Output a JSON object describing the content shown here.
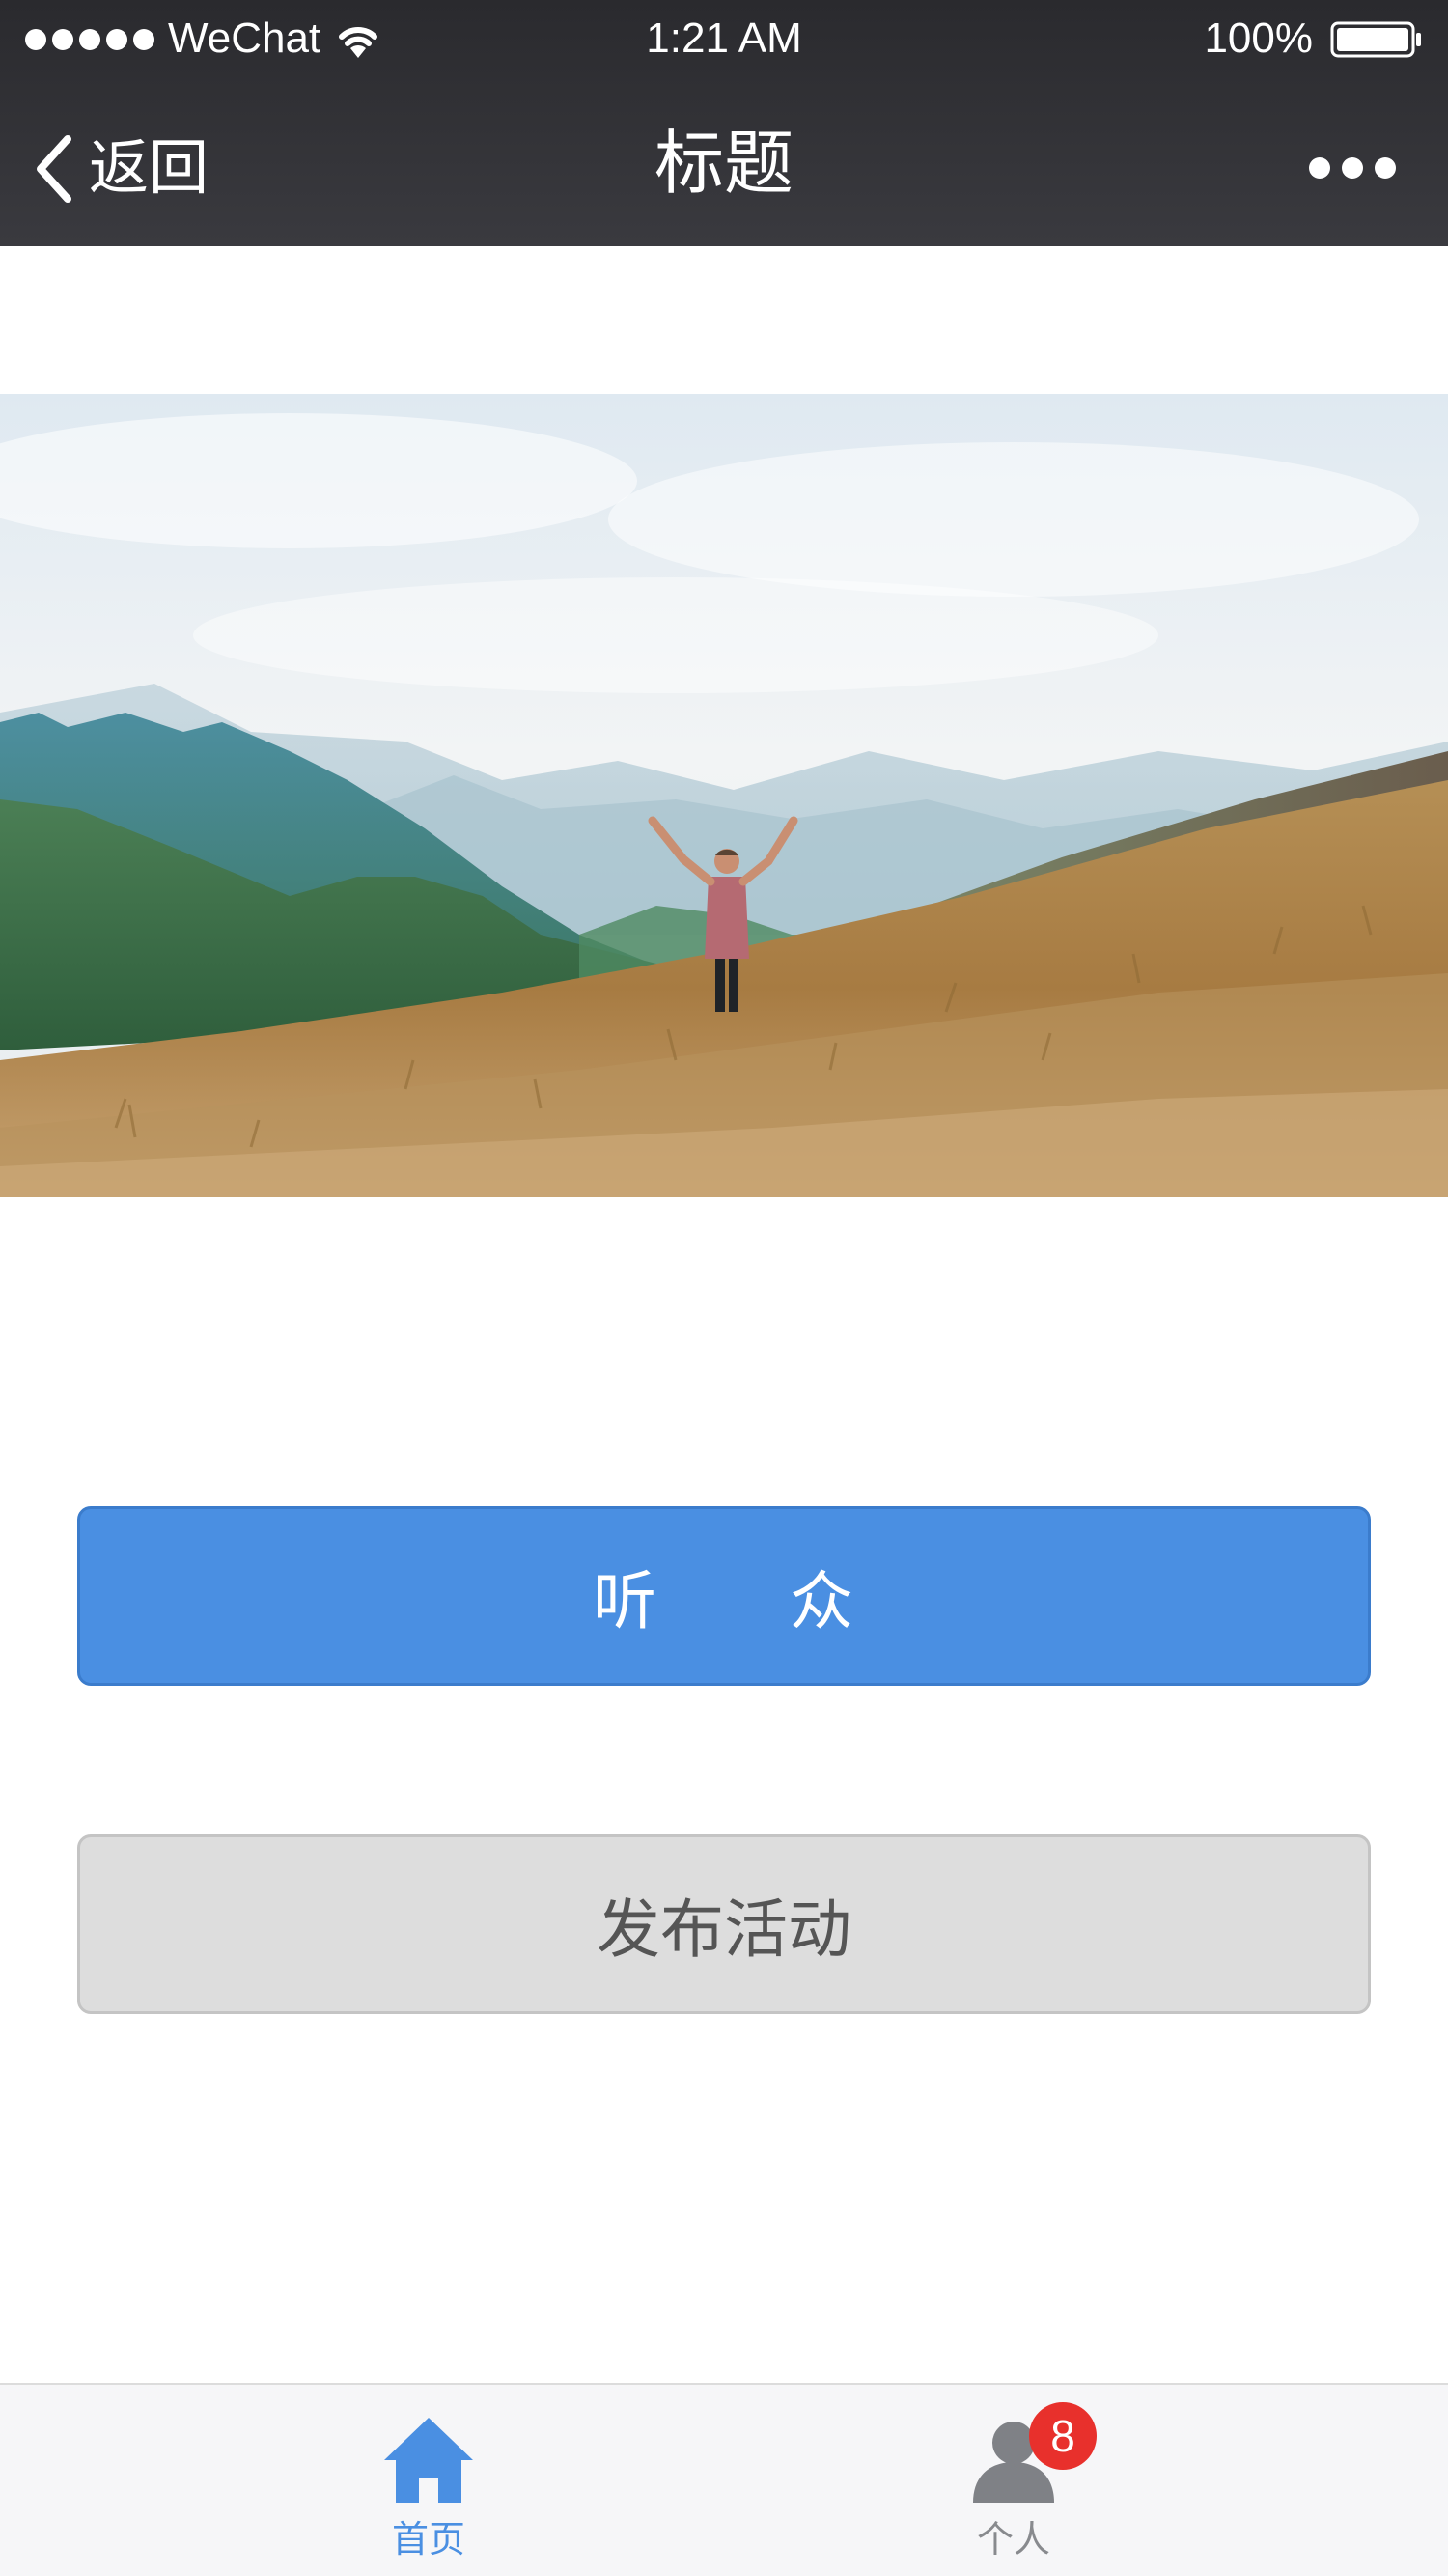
{
  "status_bar": {
    "carrier": "WeChat",
    "time": "1:21 AM",
    "battery": "100%"
  },
  "nav": {
    "back_label": "返回",
    "title": "标题"
  },
  "hero": {
    "description_icon": "mountain-photo"
  },
  "buttons": {
    "primary_label": "听　　众",
    "secondary_label": "发布活动"
  },
  "tabbar": {
    "tabs": [
      {
        "label": "首页",
        "icon": "home-icon",
        "active": true
      },
      {
        "label": "个人",
        "icon": "person-icon",
        "active": false,
        "badge": "8"
      }
    ]
  },
  "colors": {
    "accent": "#4a8fe2",
    "badge": "#e8302c",
    "nav_bg": "#333337"
  }
}
